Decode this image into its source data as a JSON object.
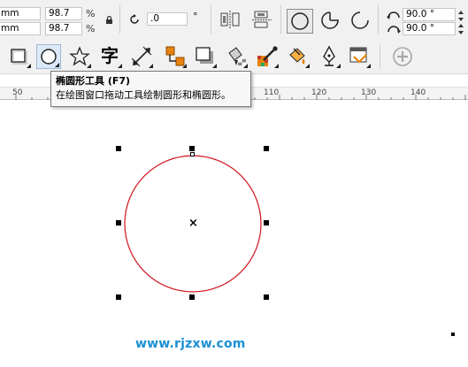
{
  "propbar": {
    "w_unit": "mm",
    "h_unit": "mm",
    "scale_x": "98.7",
    "scale_y": "98.7",
    "pct_x": "%",
    "pct_y": "%",
    "rotation": ".0",
    "degree": "°",
    "start_angle": "90.0 °",
    "end_angle": "90.0 °"
  },
  "toolbar": {
    "text_tool_glyph": "字"
  },
  "tooltip": {
    "title": "椭圆形工具 (F7)",
    "description": "在绘图窗口拖动工具绘制圆形和椭圆形。"
  },
  "ruler": {
    "labels": [
      "50",
      "110",
      "120",
      "130",
      "140"
    ]
  },
  "canvas": {
    "circle_color": "#d0151f",
    "center_mark": "×"
  },
  "watermark": "www.rjzxw.com"
}
